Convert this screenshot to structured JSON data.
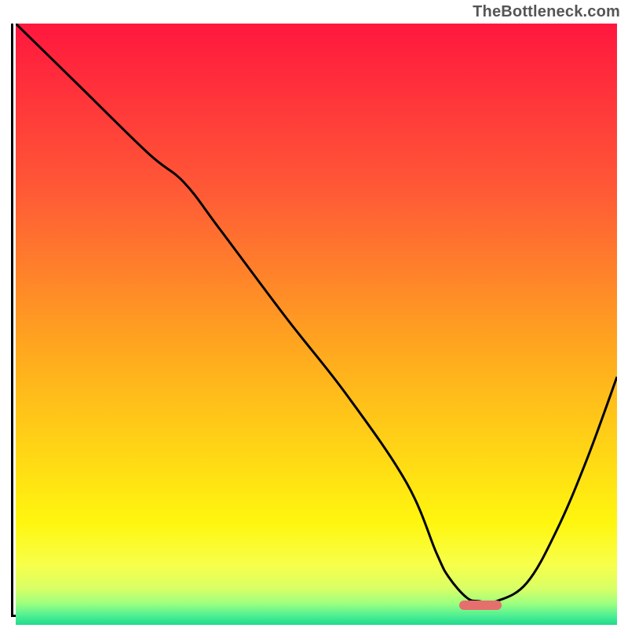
{
  "watermark": "TheBottleneck.com",
  "colors": {
    "axis": "#000000",
    "curve": "#000000",
    "marker": "#e56f6c",
    "gradient_stops": [
      {
        "offset": 0.0,
        "color": "#ff173e"
      },
      {
        "offset": 0.28,
        "color": "#ff5a36"
      },
      {
        "offset": 0.55,
        "color": "#ffaa1e"
      },
      {
        "offset": 0.72,
        "color": "#ffd815"
      },
      {
        "offset": 0.83,
        "color": "#fff60f"
      },
      {
        "offset": 0.9,
        "color": "#f7ff4a"
      },
      {
        "offset": 0.94,
        "color": "#d8ff66"
      },
      {
        "offset": 0.965,
        "color": "#9cff80"
      },
      {
        "offset": 0.985,
        "color": "#4eef93"
      },
      {
        "offset": 1.0,
        "color": "#20d98e"
      }
    ]
  },
  "chart_data": {
    "type": "line",
    "title": "",
    "xlabel": "",
    "ylabel": "",
    "xlim": [
      0,
      100
    ],
    "ylim": [
      0,
      100
    ],
    "grid": false,
    "legend": false,
    "series": [
      {
        "name": "bottleneck-curve",
        "x": [
          0,
          10,
          22,
          28,
          34,
          45,
          55,
          65,
          70,
          72,
          75,
          77,
          80,
          85,
          90,
          95,
          100
        ],
        "values": [
          100,
          90,
          78,
          73,
          65,
          50,
          37,
          22,
          10,
          6,
          2.5,
          1.9,
          1.9,
          5,
          14,
          26,
          40
        ]
      }
    ],
    "annotations": [
      {
        "type": "marker",
        "name": "optimal-band",
        "x_center": 77,
        "width_pct": 7,
        "y": 1.6
      }
    ]
  }
}
